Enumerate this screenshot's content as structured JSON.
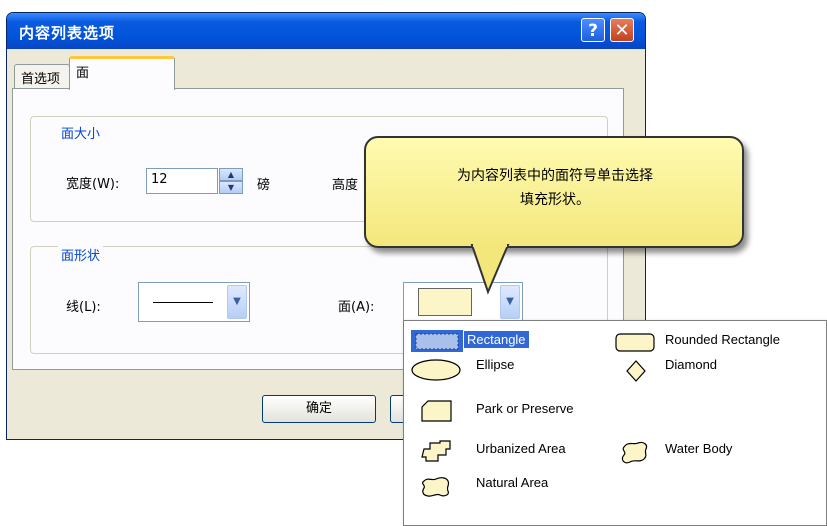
{
  "window": {
    "title": "内容列表选项",
    "help_label": "?",
    "close_label": "✕"
  },
  "tabs": [
    {
      "label": "首选项",
      "active": false
    },
    {
      "label": "面",
      "active": true
    }
  ],
  "patch_size": {
    "group_label": "面大小",
    "width_label": "宽度(W):",
    "width_value": "12",
    "width_unit": "磅",
    "height_label": "高度"
  },
  "patch_shape": {
    "group_label": "面形状",
    "line_label": "线(L):",
    "area_label": "面(A):"
  },
  "buttons": {
    "ok": "确定"
  },
  "tooltip": {
    "line1": "为内容列表中的面符号单击选择",
    "line2": "填充形状。"
  },
  "shape_options": [
    {
      "label": "Rectangle",
      "icon": "rectangle-icon",
      "selected": true
    },
    {
      "label": "Rounded Rectangle",
      "icon": "rounded-rectangle-icon",
      "selected": false
    },
    {
      "label": "Ellipse",
      "icon": "ellipse-icon",
      "selected": false
    },
    {
      "label": "Diamond",
      "icon": "diamond-icon",
      "selected": false
    },
    {
      "label": "Park or Preserve",
      "icon": "park-or-preserve-icon",
      "selected": false
    },
    {
      "label": "Urbanized Area",
      "icon": "urbanized-area-icon",
      "selected": false
    },
    {
      "label": "Water Body",
      "icon": "water-body-icon",
      "selected": false
    },
    {
      "label": "Natural Area",
      "icon": "natural-area-icon",
      "selected": false
    }
  ],
  "colors": {
    "titlebar": "#0053d8",
    "tooltip_fill": "#fff7a0",
    "selection": "#3168d5",
    "patch_fill": "#fbf5c8"
  }
}
